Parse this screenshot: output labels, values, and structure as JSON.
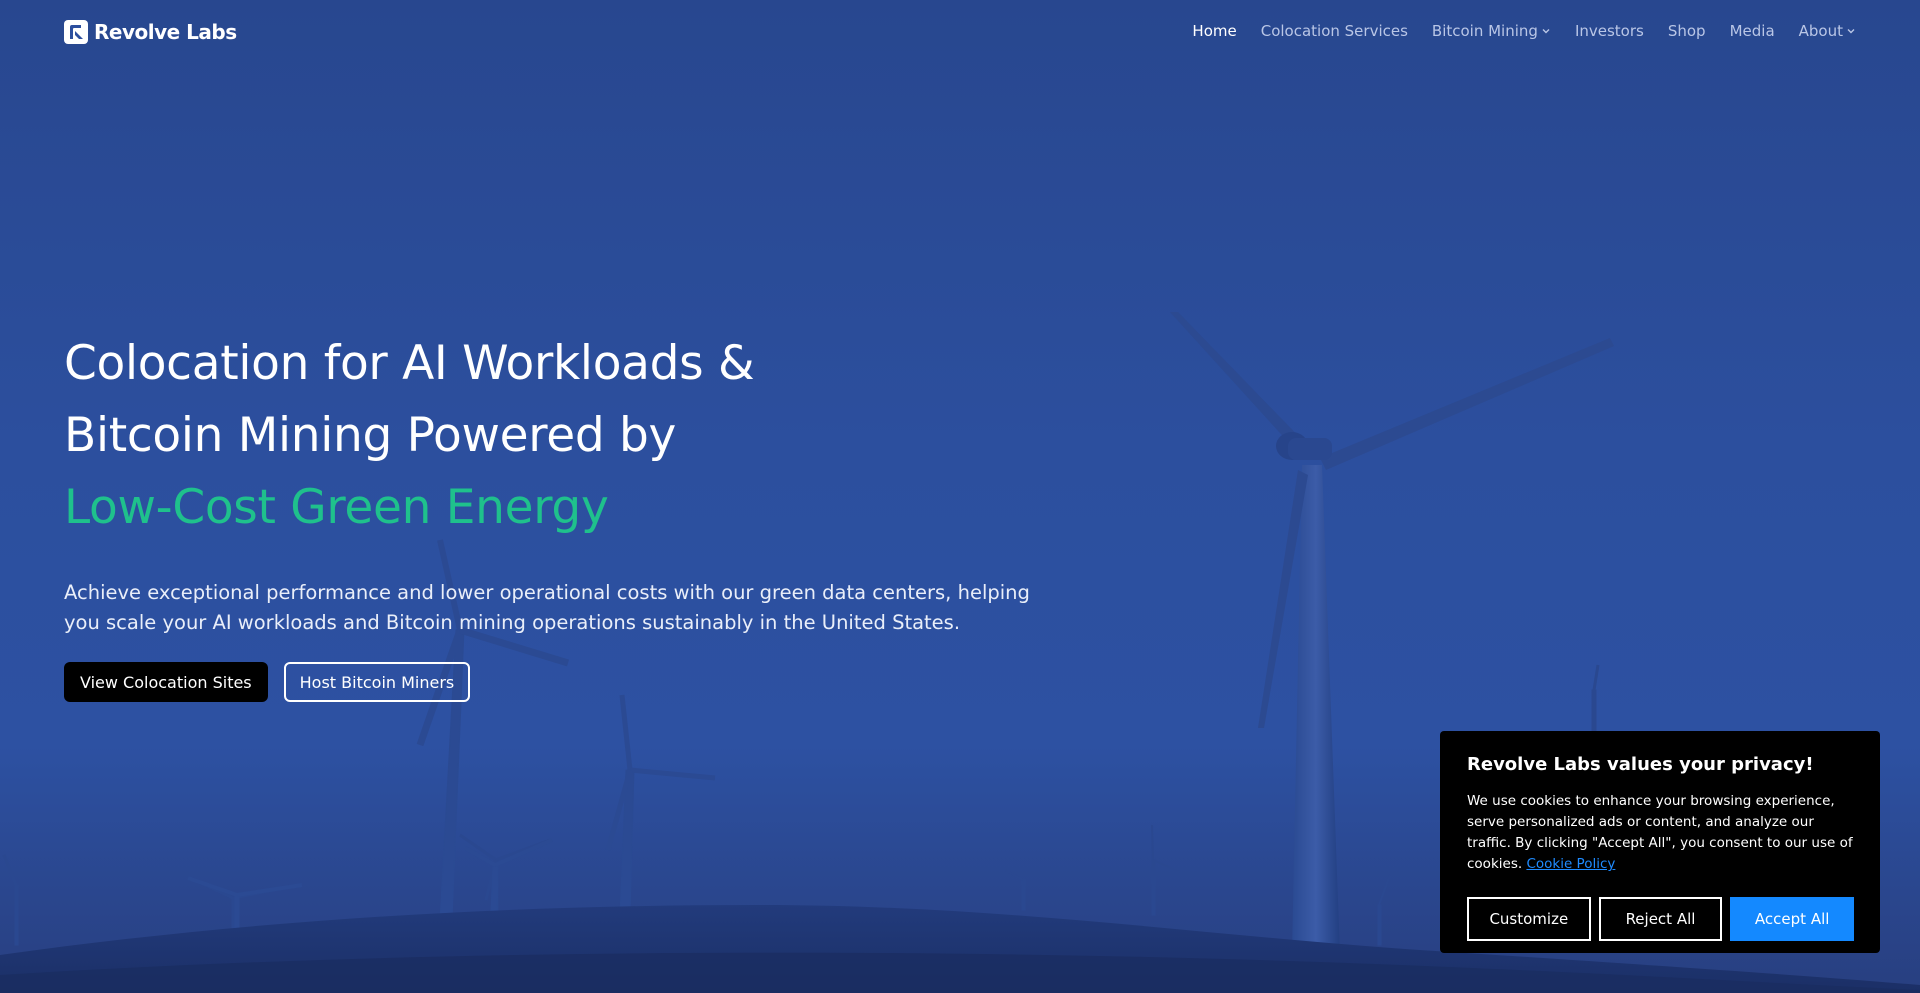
{
  "brand": {
    "name": "Revolve Labs",
    "logo_icon": "revolve-labs-logo-icon"
  },
  "nav": {
    "items": [
      {
        "label": "Home",
        "active": true,
        "dropdown": false
      },
      {
        "label": "Colocation Services",
        "active": false,
        "dropdown": false
      },
      {
        "label": "Bitcoin Mining",
        "active": false,
        "dropdown": true
      },
      {
        "label": "Investors",
        "active": false,
        "dropdown": false
      },
      {
        "label": "Shop",
        "active": false,
        "dropdown": false
      },
      {
        "label": "Media",
        "active": false,
        "dropdown": false
      },
      {
        "label": "About",
        "active": false,
        "dropdown": true
      }
    ]
  },
  "hero": {
    "title_line1": "Colocation for AI Workloads &",
    "title_line2": "Bitcoin Mining Powered by",
    "title_accent": "Low-Cost Green Energy",
    "subtitle": "Achieve exceptional performance and lower operational costs with our green data centers, helping you scale your AI workloads and Bitcoin mining operations sustainably in the United States.",
    "primary_button": "View Colocation Sites",
    "secondary_button": "Host Bitcoin Miners"
  },
  "cookie_banner": {
    "title": "Revolve Labs values your privacy!",
    "body": "We use cookies to enhance your browsing experience, serve personalized ads or content, and analyze our traffic. By clicking \"Accept All\", you consent to our use of cookies. ",
    "link": "Cookie Policy",
    "customize": "Customize",
    "reject": "Reject All",
    "accept": "Accept All"
  },
  "colors": {
    "hero_background": "#2c4f9e",
    "accent_green": "#1fc18c",
    "accept_blue": "#1489ff",
    "link_blue": "#1f8bff",
    "nav_inactive": "#b9c6e6"
  }
}
